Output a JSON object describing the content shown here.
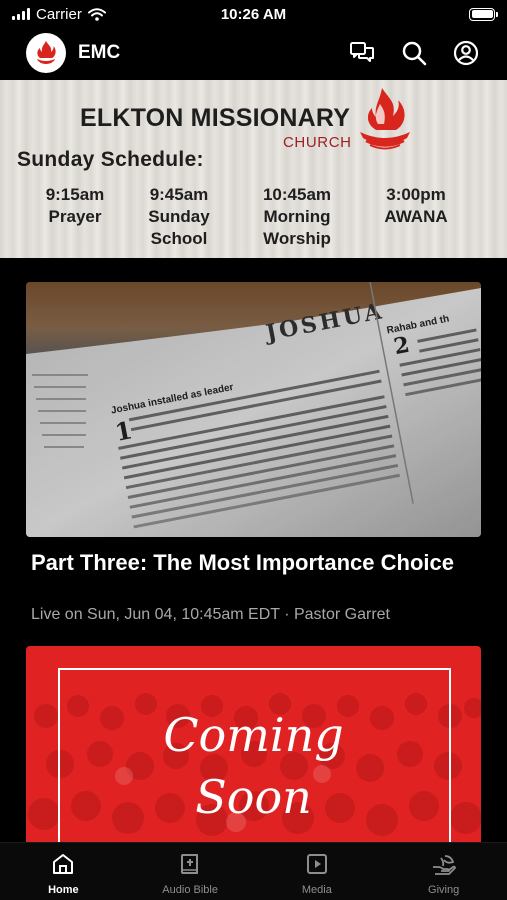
{
  "status_bar": {
    "carrier": "Carrier",
    "time": "10:26 AM"
  },
  "header": {
    "title": "EMC",
    "icons": [
      "chat-icon",
      "search-icon",
      "profile-icon"
    ]
  },
  "banner": {
    "church_name": "ELKTON MISSIONARY",
    "church_sub": "CHURCH",
    "heading": "Sunday Schedule:",
    "schedule": [
      {
        "time": "9:15am",
        "name": "Prayer"
      },
      {
        "time": "9:45am",
        "name": "Sunday\nSchool"
      },
      {
        "time": "10:45am",
        "name": "Morning\nWorship"
      },
      {
        "time": "3:00pm",
        "name": "AWANA"
      }
    ]
  },
  "sermon": {
    "title": "Part Three: The Most Importance Choice",
    "meta": "Live on Sun, Jun 04, 10:45am EDT · Pastor Garret",
    "image": {
      "header": "JOSHUA",
      "subhead": "Joshua installed as leader",
      "verse_numbers": [
        "1",
        "2"
      ],
      "side_heading": "Rahab and th"
    }
  },
  "promo": {
    "line1": "Coming",
    "line2": "Soon"
  },
  "tabs": [
    {
      "label": "Home",
      "icon": "home-icon",
      "active": true
    },
    {
      "label": "Audio Bible",
      "icon": "bible-icon",
      "active": false
    },
    {
      "label": "Media",
      "icon": "media-icon",
      "active": false
    },
    {
      "label": "Giving",
      "icon": "giving-icon",
      "active": false
    }
  ],
  "colors": {
    "accent": "#e02222",
    "flame": "#d8261f",
    "inactive_tab": "#8e8e8e"
  }
}
